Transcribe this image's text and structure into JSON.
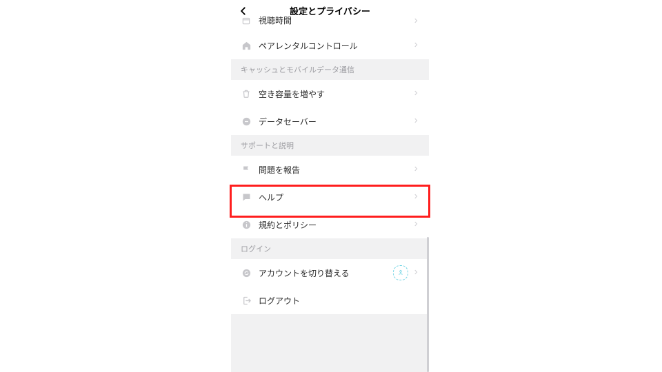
{
  "header": {
    "title": "設定とプライバシー"
  },
  "rows": {
    "viewTime": {
      "label": "視聴時間"
    },
    "parental": {
      "label": "ペアレンタルコントロール"
    },
    "freeSpace": {
      "label": "空き容量を増やす"
    },
    "dataSaver": {
      "label": "データセーバー"
    },
    "report": {
      "label": "問題を報告"
    },
    "help": {
      "label": "ヘルプ"
    },
    "policy": {
      "label": "規約とポリシー"
    },
    "switchAcct": {
      "label": "アカウントを切り替える"
    },
    "logout": {
      "label": "ログアウト"
    }
  },
  "sections": {
    "cache": "キャッシュとモバイルデータ通信",
    "support": "サポートと説明",
    "login": "ログイン"
  }
}
